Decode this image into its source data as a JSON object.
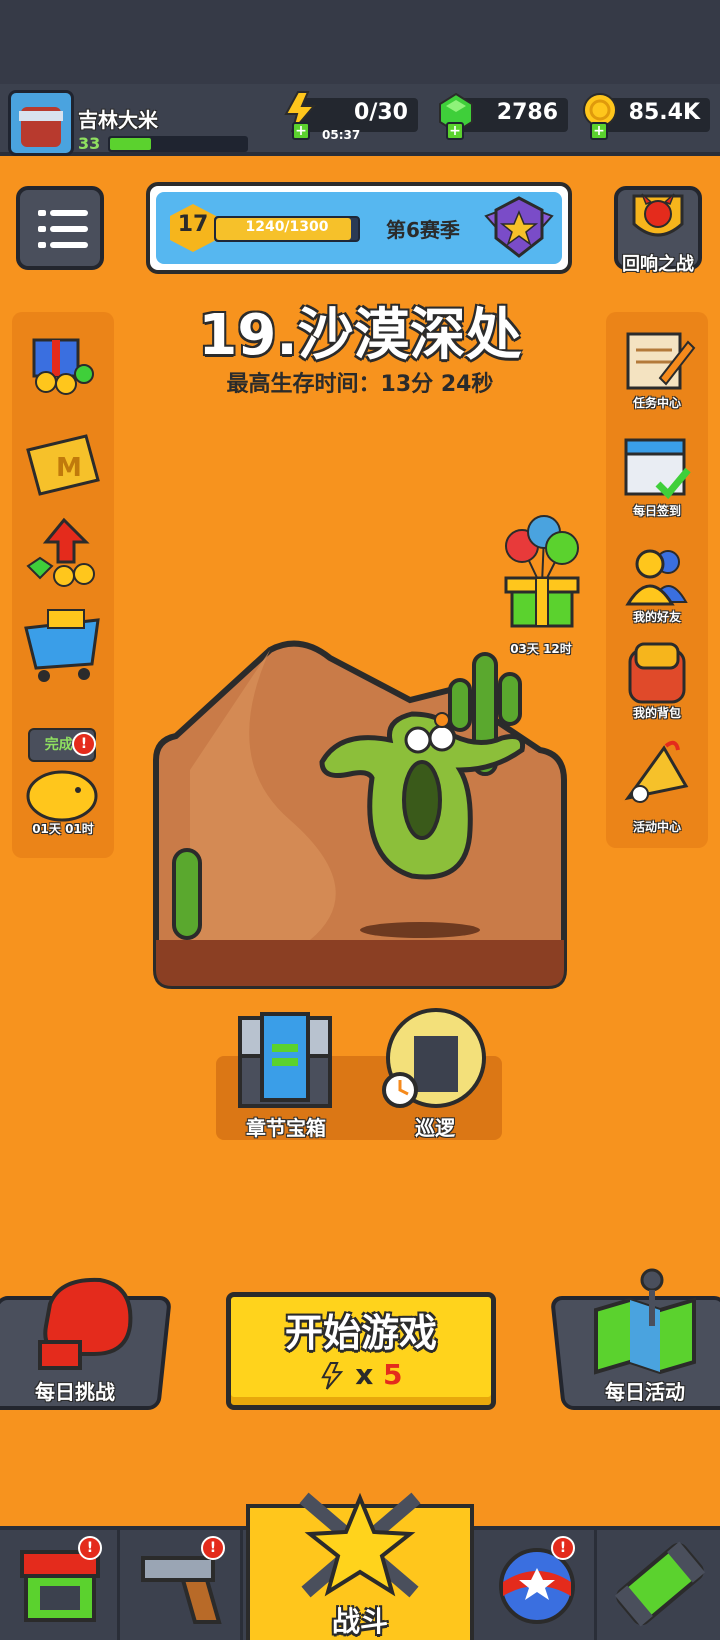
{
  "player": {
    "name": "吉林大米",
    "level": "33",
    "xp_fraction": 0.3
  },
  "resources": {
    "energy": "0/30",
    "energy_timer": "05:37",
    "gems": "2786",
    "coins": "85.4K"
  },
  "season": {
    "level": "17",
    "progress": "1240/1300",
    "progress_fraction": 0.954,
    "label": "第6赛季"
  },
  "echo_battle": {
    "label": "回响之战"
  },
  "stage": {
    "title": "19.沙漠深处",
    "best_time": "最高生存时间：13分 24秒"
  },
  "left_sidebar": {
    "piggy_bubble": "完成!",
    "piggy_timer": "01天 01时"
  },
  "right_sidebar": {
    "items": [
      "任务中心",
      "每日签到",
      "我的好友",
      "我的背包",
      "活动中心"
    ],
    "gift_timer": "03天 12时"
  },
  "stage_actions": {
    "chest": "章节宝箱",
    "patrol": "巡逻"
  },
  "actions": {
    "daily_challenge": "每日挑战",
    "start": "开始游戏",
    "start_cost_x": "x",
    "start_cost_n": "5",
    "daily_event": "每日活动"
  },
  "nav": {
    "battle": "战斗"
  },
  "colors": {
    "background": "#f7931e",
    "accent_yellow": "#ffd31c",
    "dark_panel": "#3c414e",
    "badge_red": "#e42b1c"
  }
}
